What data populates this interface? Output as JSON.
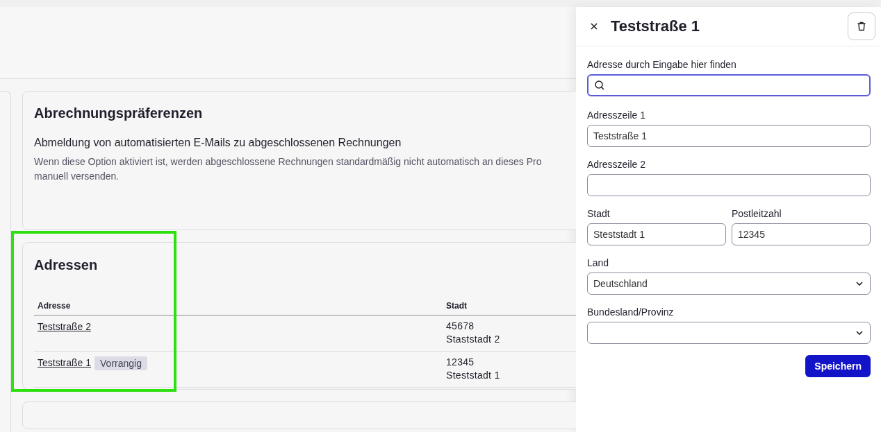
{
  "billing": {
    "title": "Abrechnungspräferenzen",
    "option_title": "Abmeldung von automatisierten E-Mails zu abgeschlossenen Rechnungen",
    "description_lines": [
      "Wenn diese Option aktiviert ist, werden abgeschlossene Rechnungen standardmäßig nicht automatisch an dieses Pro",
      "manuell versenden."
    ]
  },
  "addresses": {
    "title": "Adressen",
    "highlighted": true,
    "columns": [
      "Adresse",
      "Stadt"
    ],
    "rows": [
      {
        "address": "Teststraße 2",
        "postal_code": "45678",
        "city": "Staststadt 2"
      },
      {
        "address": "Teststraße 1",
        "badge": "Vorrangig",
        "postal_code": "12345",
        "city": "Steststadt 1"
      }
    ]
  },
  "panel": {
    "title": "Teststraße 1",
    "search": {
      "label": "Adresse durch Eingabe hier finden",
      "focused": true
    },
    "fields": [
      {
        "kind": "text",
        "label": "Adresszeile 1",
        "value": "Teststraße 1",
        "half": false
      },
      {
        "kind": "text",
        "label": "Adresszeile 2",
        "half": false
      },
      {
        "kind": "text",
        "label": "Stadt",
        "value": "Steststadt 1",
        "half": true
      },
      {
        "kind": "text",
        "label": "Postleitzahl",
        "value": "12345",
        "half": true
      },
      {
        "kind": "select",
        "label": "Land",
        "value": "Deutschland",
        "half": false
      },
      {
        "kind": "select",
        "label": "Bundesland/Provinz",
        "half": false
      }
    ],
    "save_label": "Speichern"
  }
}
